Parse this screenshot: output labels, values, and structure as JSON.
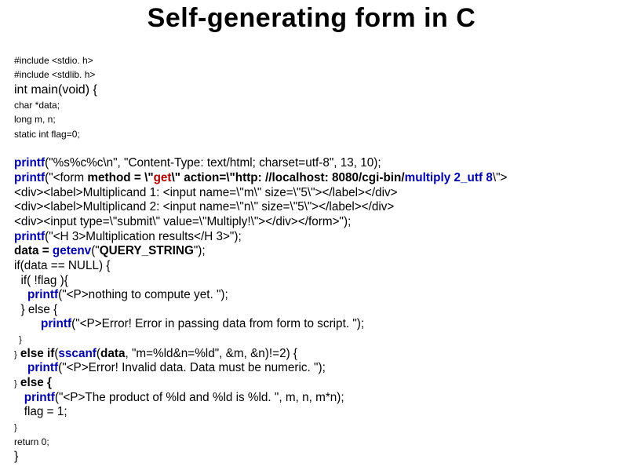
{
  "title": "Self-generating form in C",
  "code": {
    "inc1": "#include <stdio. h>",
    "inc2": "#include <stdlib. h>",
    "main_sig": "int main(void) {",
    "decl1": "char *data;",
    "decl2": "long m, n;",
    "decl3": "static int flag=0;",
    "l1a": "printf",
    "l1b": "(\"%s%c%c\\n\", \"Content-Type: text/html; charset=utf-8\", 13, 10);",
    "l2a": "printf",
    "l2b": "(\"<form ",
    "l2c": "method = \\\"",
    "l2d": "get",
    "l2e": "\\\" action=\\\"http: //localhost: 8080/cgi-bin/",
    "l2f": "multiply 2_utf 8",
    "l2g": "\\\">",
    "l3": "<div><label>Multiplicand 1: <input name=\\\"m\\\" size=\\\"5\\\"></label></div>",
    "l4": "<div><label>Multiplicand 2: <input name=\\\"n\\\" size=\\\"5\\\"></label></div>",
    "l5": "<div><input type=\\\"submit\\\" value=\\\"Multiply!\\\"></div></form>\");",
    "l6a": "printf",
    "l6b": "(\"<H 3>Multiplication results</H 3>\");",
    "l7a": "data = ",
    "l7b": "getenv",
    "l7c": "(\"",
    "l7d": "QUERY_STRING",
    "l7e": "\");",
    "l8": "if(data == NULL) {",
    "l9": "  if( !flag ){",
    "l10a": "    ",
    "l10b": "printf",
    "l10c": "(\"<P>nothing to compute yet. \");",
    "l11": "  } else {",
    "l12a": "        ",
    "l12b": "printf",
    "l12c": "(\"<P>Error! Error in passing data from form to script. \");",
    "l13t": "  }",
    "l14a": "}",
    "l14b": " else if",
    "l14c": "(",
    "l14d": "sscanf",
    "l14e": "(",
    "l14f": "data",
    "l14g": ", \"m=%ld&n=%ld\", &m, &n)!=2) {",
    "l15a": "    ",
    "l15b": "printf",
    "l15c": "(\"<P>Error! Invalid data. Data must be numeric. \");",
    "l16a": "}",
    "l16b": " else {",
    "l17a": "   ",
    "l17b": "printf",
    "l17c": "(\"<P>The product of %ld and %ld is %ld. \", m, n, m*n);",
    "l18": "   flag = 1;",
    "l19": "}",
    "ret": "return 0;",
    "end": "}"
  }
}
